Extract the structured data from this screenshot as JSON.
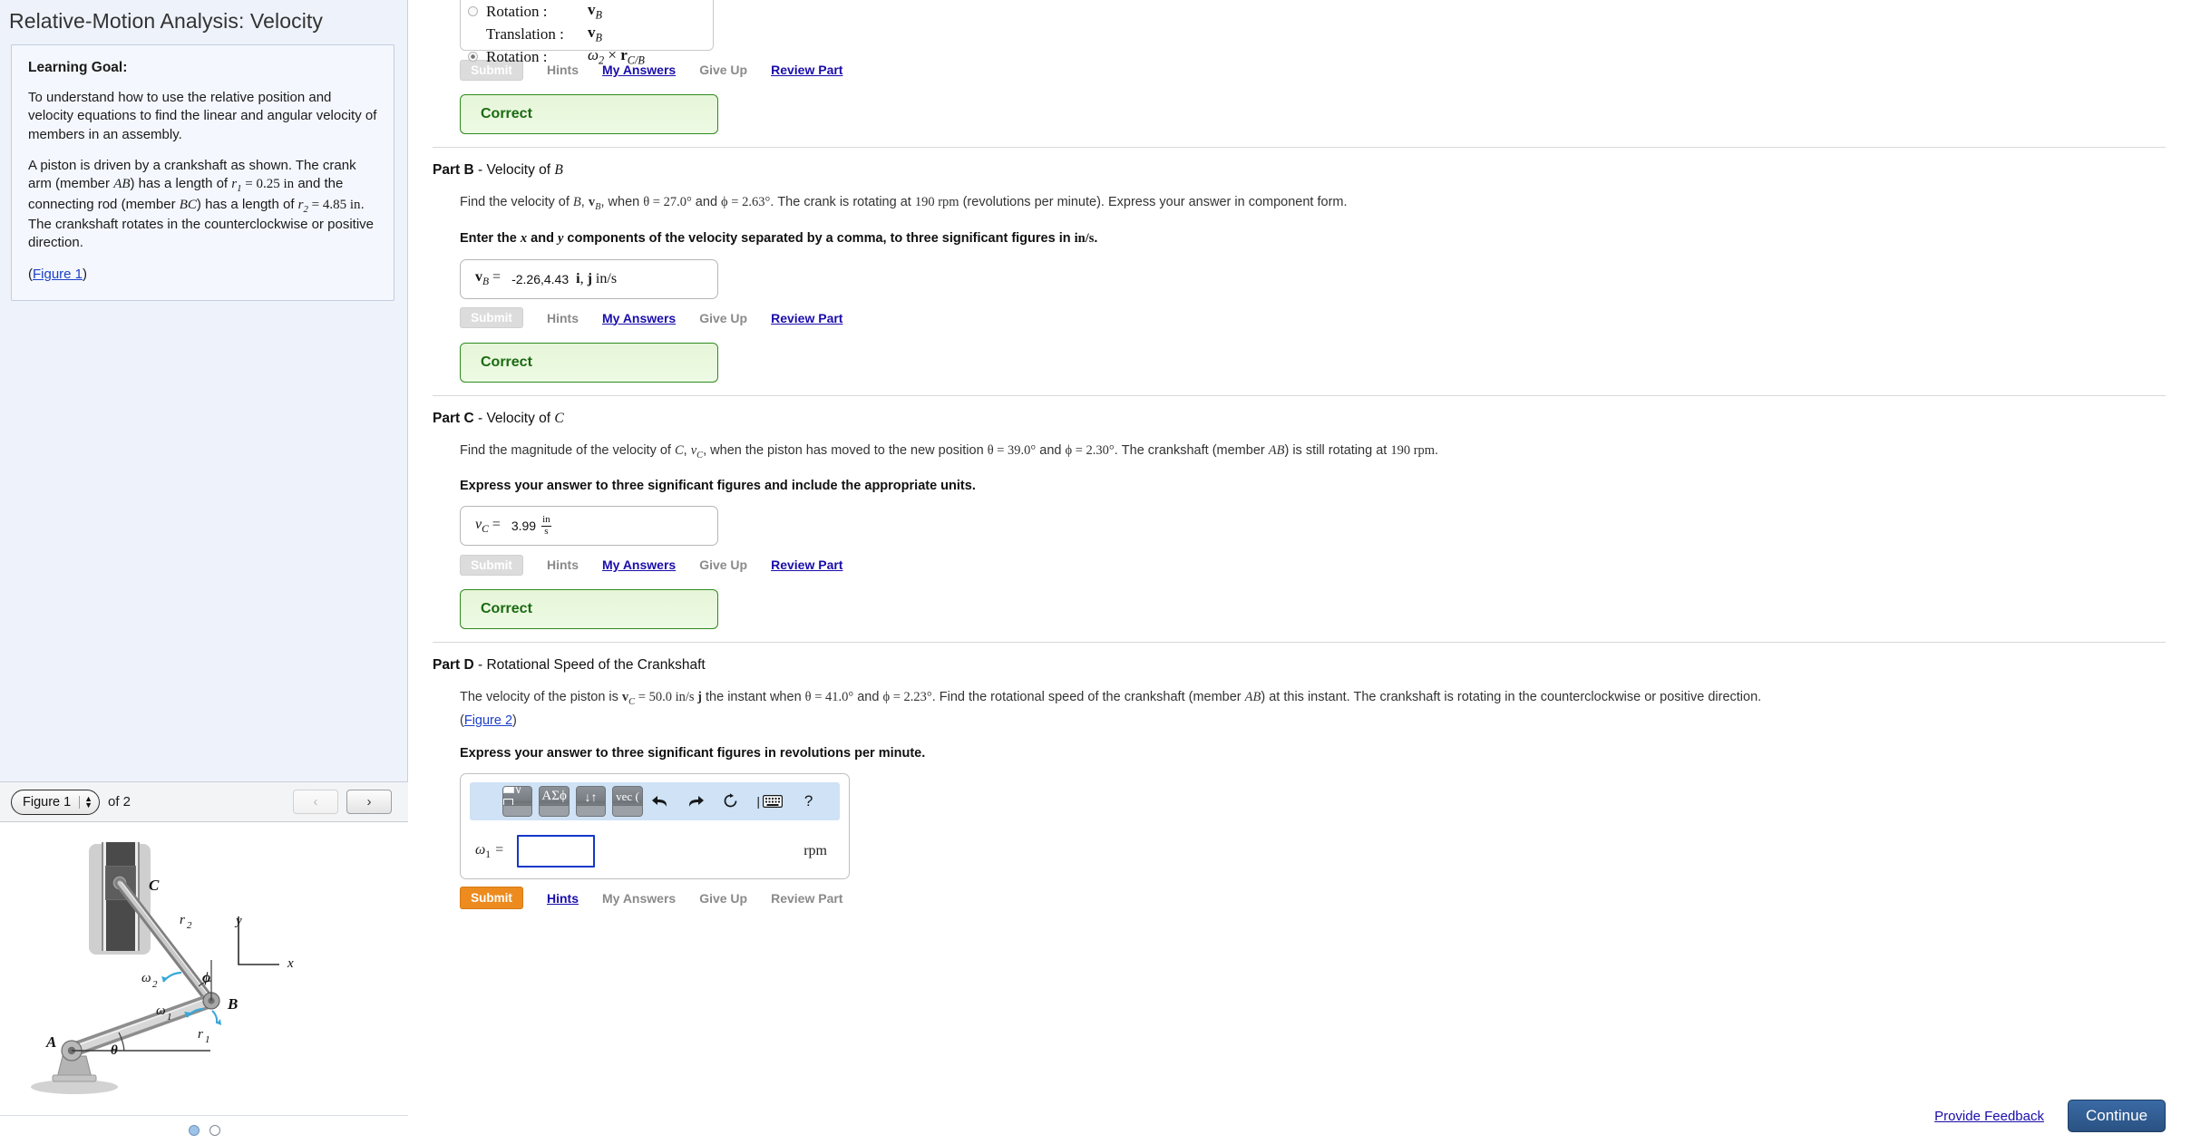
{
  "page_title": "Relative-Motion Analysis: Velocity",
  "problem": {
    "goal_heading": "Learning Goal:",
    "goal_text": "To understand how to use the relative position and velocity equations to find the linear and angular velocity of members in an assembly.",
    "setup_pre": "A piston is driven by a crankshaft as shown. The crank arm (member ",
    "member_ab": "AB",
    "setup_mid1": ") has a length of ",
    "r1_eq": "r",
    "r1_val": " = 0.25 in",
    "setup_mid2": " and the connecting rod (member ",
    "member_bc": "BC",
    "setup_mid3": ") has a length of ",
    "r2_val": " = 4.85 in",
    "setup_end": ". The crankshaft rotates in the counterclockwise or positive direction.",
    "figure_link": "Figure 1",
    "paren_open": "(",
    "paren_close": ")"
  },
  "figure_panel": {
    "selected": "Figure 1",
    "options": [
      "Figure 1",
      "Figure 2"
    ],
    "of_label": "of 2",
    "prev_icon": "chevron-left-icon",
    "next_icon": "chevron-right-icon",
    "dots": 2,
    "active_dot": 1,
    "diagram": {
      "label_a": "A",
      "label_b": "B",
      "label_c": "C",
      "label_r1": "r",
      "label_r2": "r",
      "label_w1": "ω",
      "label_w2": "ω",
      "label_theta": "θ",
      "label_phi": "ϕ",
      "axis_x": "x",
      "axis_y": "y"
    }
  },
  "part_a_tail": {
    "rows": [
      {
        "radio": "off",
        "label": "Rotation :",
        "value": "v",
        "value_sub": "B",
        "value_extra": ""
      },
      {
        "radio": "blank",
        "label": "Translation :",
        "value": "v",
        "value_sub": "B",
        "value_extra": ""
      },
      {
        "radio": "on",
        "label": "Rotation :",
        "value": "ω",
        "value_sub": "2",
        "value_extra": " × r"
      }
    ],
    "submit_label": "Submit",
    "hints_label": "Hints",
    "my_answers_label": "My Answers",
    "give_up_label": "Give Up",
    "review_part_label": "Review Part",
    "feedback": "Correct"
  },
  "part_b": {
    "heading_bold": "Part B",
    "heading_dash": " - ",
    "heading_rest": "Velocity of ",
    "heading_var": "B",
    "question_1": "Find the velocity of ",
    "question_2": ", when ",
    "theta_val": "θ = 27.0°",
    "and_1": " and ",
    "phi_val": "ϕ = 2.63°",
    "question_3": ". The crank is rotating at ",
    "rpm_val": "190 rpm",
    "question_4": " (revolutions per minute). Express your answer in component form.",
    "instruction_a": "Enter the ",
    "instruction_x": "x",
    "instruction_b": " and ",
    "instruction_y": "y",
    "instruction_c": " components of the velocity separated by a comma, to three significant figures in ",
    "instruction_units": "in/s",
    "instruction_d": ".",
    "answer_label": "v",
    "answer_sub": "B",
    "answer_eq": " = ",
    "answer_value": "-2.26,4.43",
    "answer_units": "i, j in/s",
    "submit_label": "Submit",
    "hints_label": "Hints",
    "my_answers_label": "My Answers",
    "give_up_label": "Give Up",
    "review_part_label": "Review Part",
    "feedback": "Correct"
  },
  "part_c": {
    "heading_bold": "Part C",
    "heading_dash": " - ",
    "heading_rest": "Velocity of ",
    "heading_var": "C",
    "question_1": "Find the magnitude of the velocity of ",
    "question_2": ", when the piston has moved to the new position ",
    "theta_val": "θ = 39.0°",
    "and_1": " and ",
    "phi_val": "ϕ = 2.30°",
    "question_3": ". The crankshaft (member ",
    "member_ab": "AB",
    "question_4": ") is still rotating at ",
    "rpm_val": "190 rpm",
    "question_5": ".",
    "instruction": "Express your answer to three significant figures and include the appropriate units.",
    "answer_label": "v",
    "answer_sub": "C",
    "answer_eq": " = ",
    "answer_value": "3.99",
    "unit_num": "in",
    "unit_den": "s",
    "submit_label": "Submit",
    "hints_label": "Hints",
    "my_answers_label": "My Answers",
    "give_up_label": "Give Up",
    "review_part_label": "Review Part",
    "feedback": "Correct"
  },
  "part_d": {
    "heading_bold": "Part D",
    "heading_dash": " - ",
    "heading_rest": "Rotational Speed of the Crankshaft",
    "question_1": "The velocity of the piston is ",
    "vc_val": " = 50.0 in/s ",
    "question_2": " the instant when ",
    "theta_val": "θ = 41.0°",
    "and_1": " and ",
    "phi_val": "ϕ = 2.23°",
    "question_3": ". Find the rotational speed of the crankshaft (member ",
    "member_ab": "AB",
    "question_4": ") at this instant. The crankshaft is rotating in the counterclockwise or positive direction.",
    "figure_link": "Figure 2",
    "paren_open": "(",
    "paren_close": ")",
    "instruction": "Express your answer to three significant figures in revolutions per minute.",
    "toolbar": {
      "keys": [
        {
          "name": "template-sqrt-key",
          "glyph": "√"
        },
        {
          "name": "greek-letters-key",
          "glyph": "ΑΣϕ"
        },
        {
          "name": "sub-superscript-key",
          "glyph": "↓↑"
        },
        {
          "name": "vector-key",
          "glyph": "vec ("
        }
      ],
      "icons": [
        {
          "name": "undo-icon",
          "glyph": "↶"
        },
        {
          "name": "redo-icon",
          "glyph": "↷"
        },
        {
          "name": "reset-icon",
          "glyph": "↻"
        },
        {
          "name": "keyboard-icon",
          "glyph": "⌨"
        },
        {
          "name": "help-icon",
          "glyph": "?"
        }
      ]
    },
    "input_label": "ω",
    "input_sub": "1",
    "input_eq": " = ",
    "input_value": "",
    "unit_label": "rpm",
    "submit_label": "Submit",
    "hints_label": "Hints",
    "my_answers_label": "My Answers",
    "give_up_label": "Give Up",
    "review_part_label": "Review Part"
  },
  "footer": {
    "provide_feedback": "Provide Feedback",
    "continue_label": "Continue"
  },
  "colors": {
    "accent_blue": "#1a0dab",
    "correct_green": "#2e8b20",
    "submit_orange": "#ed8b1f",
    "continue_blue": "#2a5283",
    "panel_bg": "#eef2fa"
  }
}
